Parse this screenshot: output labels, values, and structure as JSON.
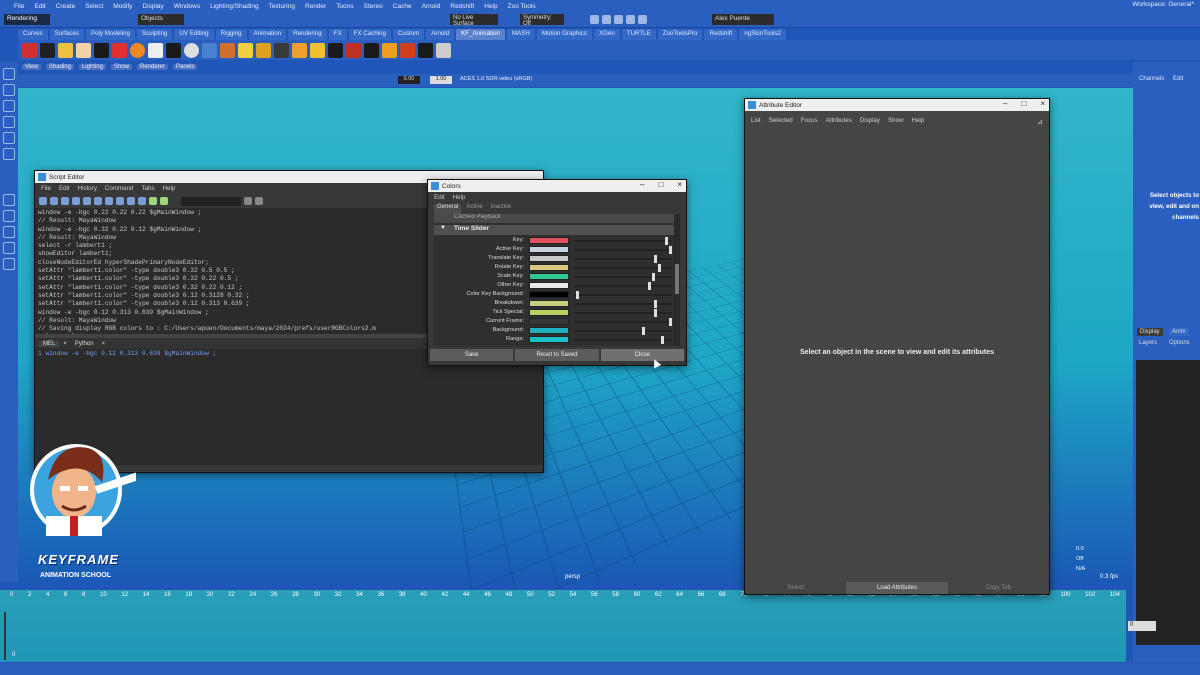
{
  "menubar": {
    "items": [
      "File",
      "Edit",
      "Create",
      "Select",
      "Modify",
      "Display",
      "Windows",
      "Lighting/Shading",
      "Texturing",
      "Render",
      "Toons",
      "Stereo",
      "Cache",
      "Arnold",
      "Redshift",
      "Help",
      "Zoo Tools"
    ],
    "workspace": "Workspace: General*"
  },
  "status": {
    "mode": "Rendering",
    "select_type": "Objects",
    "live_surface": "No Live Surface",
    "symmetry": "Symmetry: Off",
    "user": "Alex Puente"
  },
  "shelf_tabs": [
    "Curves",
    "Surfaces",
    "Poly Modeling",
    "Sculpting",
    "UV Editing",
    "Rigging",
    "Animation",
    "Rendering",
    "FX",
    "FX Caching",
    "Custom",
    "Arnold",
    "KF_Animation",
    "MASH",
    "Motion Graphics",
    "XGen",
    "TURTLE",
    "ZooToolsPro",
    "Redshift",
    "ngSkinTools2"
  ],
  "active_shelf": "KF_Animation",
  "panel_menu": [
    "View",
    "Shading",
    "Lighting",
    "Show",
    "Renderer",
    "Panels"
  ],
  "viewport": {
    "camera": "persp",
    "fields": [
      "0.00",
      "1.00"
    ],
    "colorspace": "ACES 1.0 SDR-video (sRGB)",
    "fps": "0.3 fps",
    "hud": [
      "0.0",
      "Off",
      "N/A"
    ]
  },
  "right_panel": {
    "tabs": [
      "Channels",
      "Edit"
    ],
    "hint": "Select objects to view, edit and on channels",
    "display_tabs": [
      "Display",
      "Anim"
    ],
    "sub_tabs": [
      "Layers",
      "Options"
    ]
  },
  "script_editor": {
    "title": "Script Editor",
    "menu": [
      "File",
      "Edit",
      "History",
      "Command",
      "Tabs",
      "Help"
    ],
    "history": [
      "window -e -bgc 0.22 0.22 0.22 $gMainWindow ;",
      "// Result: MayaWindow",
      "window -e -bgc 0.32 0.22 0.12 $gMainWindow ;",
      "// Result: MayaWindow",
      "select -r lambert1 ;",
      "showEditor lambert1;",
      "closeNodeEditorEd hyperShadePrimaryNodeEditor;",
      "setAttr \"lambert1.color\" -type double3 0.32 0.5 0.5 ;",
      "setAttr \"lambert1.color\" -type double3 0.32 0.22 0.5 ;",
      "setAttr \"lambert1.color\" -type double3 0.32 0.22 0.12 ;",
      "setAttr \"lambert1.color\" -type double3 0.12 0.3128 0.32 ;",
      "setAttr \"lambert1.color\" -type double3 0.12 0.313 0.639 ;",
      "window -e -bgc 0.12 0.313 0.639 $gMainWindow ;",
      "// Result: MayaWindow",
      "// Saving display RGB colors to : C:/Users/apuen/Documents/maya/2024/prefs/userRGBColors2.m",
      "select -cl ;"
    ],
    "tabs": [
      "MEL",
      "Python"
    ],
    "input_line_no": "1",
    "input": "window -e -bgc 0.12 0.313 0.639 $gMainWindow ;"
  },
  "colors": {
    "title": "Colors",
    "menu": [
      "Edit",
      "Help"
    ],
    "tabs": [
      "General",
      "Active",
      "Inactive"
    ],
    "section_above": "Cached Playback",
    "section": "Time Slider",
    "rows": [
      {
        "label": "Key:",
        "color": "#e0505f",
        "value": 0.96
      },
      {
        "label": "Active Key:",
        "color": "#c8d4e0",
        "value": 1.0
      },
      {
        "label": "Translate Key:",
        "color": "#c8c8c8",
        "value": 0.84
      },
      {
        "label": "Rotate Key:",
        "color": "#d8c880",
        "value": 0.88
      },
      {
        "label": "Scale Key:",
        "color": "#2ec890",
        "value": 0.82
      },
      {
        "label": "Other Key:",
        "color": "#e8e8e8",
        "value": 0.78
      },
      {
        "label": "Color Key Background:",
        "color": "#000000",
        "value": 0.02
      },
      {
        "label": "Breakdown:",
        "color": "#c8d080",
        "value": 0.84
      },
      {
        "label": "Tick Special:",
        "color": "#b8d060",
        "value": 0.84
      },
      {
        "label": "Current Frame:",
        "color": "#383838",
        "value": 1.0
      },
      {
        "label": "Background:",
        "color": "#20b0c0",
        "value": 0.72
      },
      {
        "label": "Range:",
        "color": "#18c0c8",
        "value": 0.92
      }
    ],
    "buttons": {
      "save": "Save",
      "reset": "Reset to Saved",
      "close": "Close"
    }
  },
  "attribute_editor": {
    "title": "Attribute Editor",
    "menu": [
      "List",
      "Selected",
      "Focus",
      "Attributes",
      "Display",
      "Show",
      "Help"
    ],
    "message": "Select an object in the scene to view and edit its attributes",
    "buttons": {
      "select": "Select",
      "load": "Load Attributes",
      "copy": "Copy Tab"
    }
  },
  "timeline": {
    "ticks": [
      "0",
      "2",
      "4",
      "6",
      "8",
      "10",
      "12",
      "14",
      "16",
      "18",
      "20",
      "22",
      "24",
      "26",
      "28",
      "30",
      "32",
      "34",
      "36",
      "38",
      "40",
      "42",
      "44",
      "46",
      "48",
      "50",
      "52",
      "54",
      "56",
      "58",
      "60",
      "62",
      "64",
      "66",
      "68",
      "70",
      "72",
      "74",
      "76",
      "78",
      "80",
      "82",
      "84",
      "86",
      "88",
      "90",
      "92",
      "94",
      "96",
      "98",
      "100",
      "102",
      "104"
    ],
    "current_value": "0",
    "start": "0"
  },
  "logo": {
    "line1": "KEYFRAME",
    "line2": "ANIMATION SCHOOL"
  }
}
